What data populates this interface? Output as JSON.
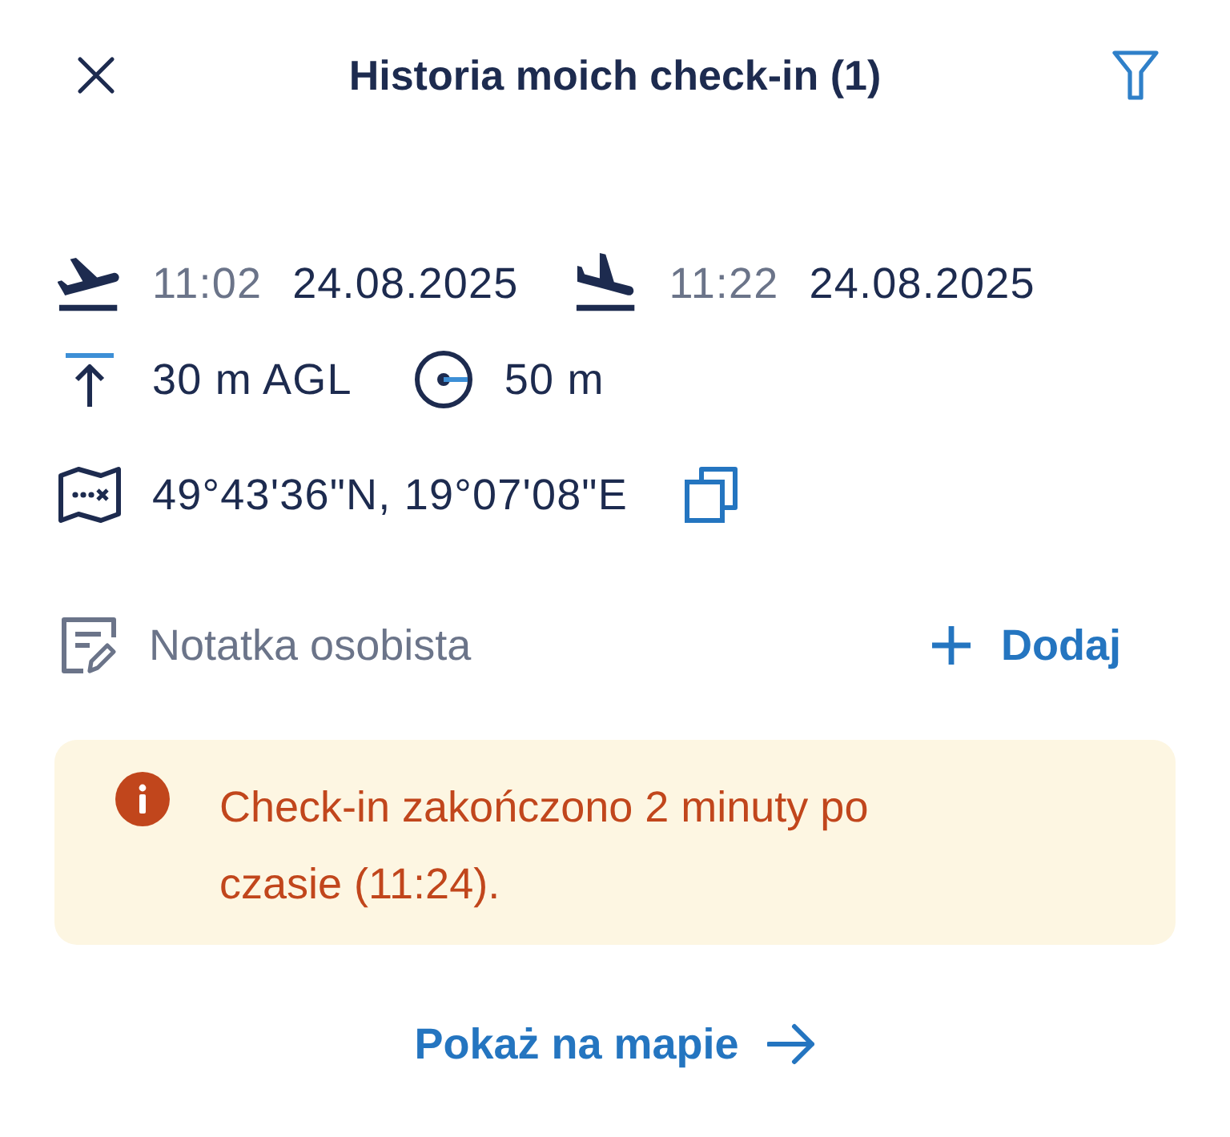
{
  "header": {
    "title": "Historia moich check-in (1)"
  },
  "events": [
    {
      "kind": "takeoff",
      "time": "11:02",
      "date": "24.08.2025"
    },
    {
      "kind": "landing",
      "time": "11:22",
      "date": "24.08.2025"
    }
  ],
  "flight": {
    "altitude": "30 m AGL",
    "radius": "50 m",
    "coordinates": "49°43'36\"N, 19°07'08\"E"
  },
  "note": {
    "label": "Notatka osobista",
    "add_button": "Dodaj"
  },
  "alert": {
    "kind": "warning",
    "text": "Check-in zakończono 2 minuty po czasie (11:24)."
  },
  "map_link": {
    "label": "Pokaż na mapie"
  }
}
